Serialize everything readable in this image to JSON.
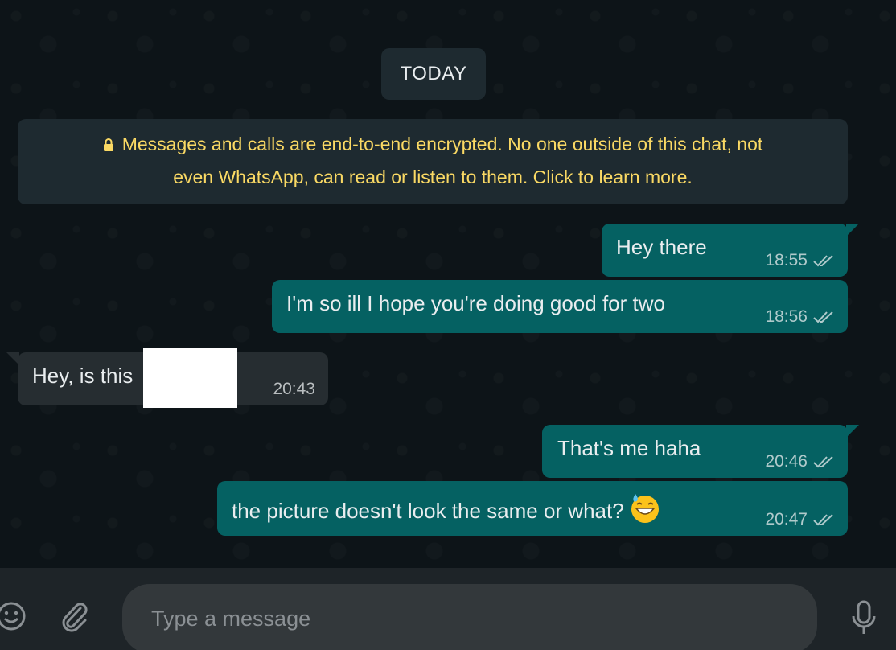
{
  "chat": {
    "date_chip": "TODAY",
    "encryption_notice": {
      "line1": "Messages and calls are end-to-end encrypted. No one outside of this chat, not",
      "line2": "even WhatsApp, can read or listen to them. Click to learn more."
    },
    "messages": [
      {
        "direction": "out",
        "text": "Hey there",
        "time": "18:55",
        "status": "read"
      },
      {
        "direction": "out",
        "text": "I'm so ill I hope you're doing good for two",
        "time": "18:56",
        "status": "read"
      },
      {
        "direction": "in",
        "text": "Hey, is this",
        "time": "20:43"
      },
      {
        "direction": "out",
        "text": "That's me haha",
        "time": "20:46",
        "status": "read"
      },
      {
        "direction": "out",
        "text": "the picture doesn't look the same or what?",
        "time": "20:47",
        "status": "read",
        "emoji": "grinning-face-with-sweat"
      }
    ]
  },
  "composer": {
    "placeholder": "Type a message",
    "icons": [
      "emoji-icon",
      "paperclip-icon",
      "microphone-icon"
    ]
  },
  "colors": {
    "background": "#0d1418",
    "outgoing_bubble": "#056162",
    "incoming_bubble": "#262d31",
    "notice_text": "#fad964",
    "footer": "#1e2428",
    "input": "#33383b"
  }
}
